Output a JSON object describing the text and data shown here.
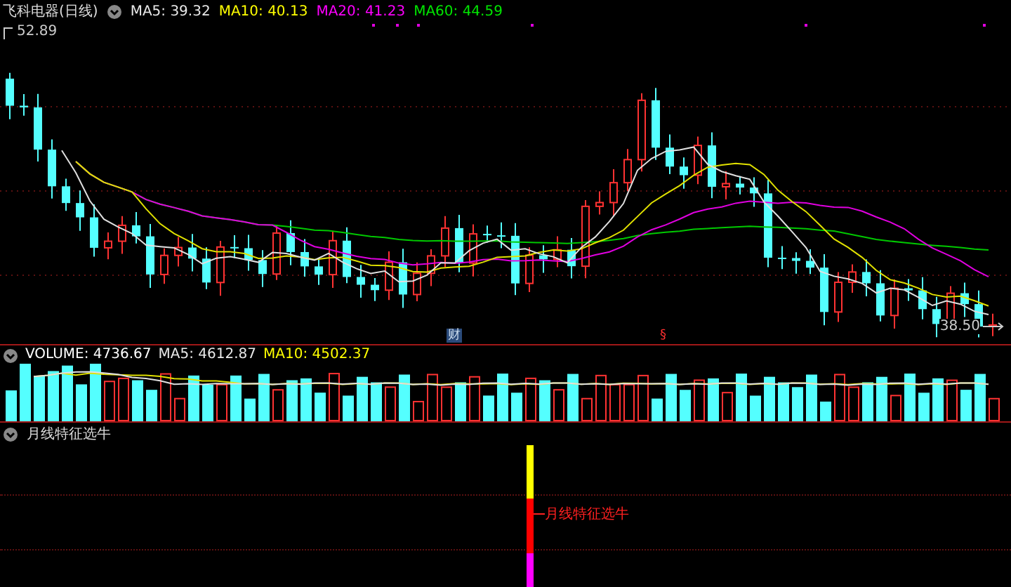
{
  "price_panel": {
    "title": "飞科电器(日线)",
    "indicators": [
      {
        "label": "MA5: 39.32",
        "color": "#e8e8e8"
      },
      {
        "label": "MA10: 40.13",
        "color": "#ffff00"
      },
      {
        "label": "MA20: 41.23",
        "color": "#ff00ff"
      },
      {
        "label": "MA60: 44.59",
        "color": "#00e600"
      }
    ],
    "high_label": "52.89",
    "low_label": "38.50",
    "markers": [
      {
        "text": "财",
        "kind": "finance"
      },
      {
        "text": "§",
        "kind": "event"
      }
    ]
  },
  "volume_panel": {
    "indicators": [
      {
        "label": "VOLUME: 4736.67",
        "color": "#ffffff"
      },
      {
        "label": "MA5: 4612.87",
        "color": "#e8e8e8"
      },
      {
        "label": "MA10: 4502.37",
        "color": "#ffff00"
      }
    ]
  },
  "signal_panel": {
    "title": "月线特征选牛",
    "signal_label": "月线特征选牛"
  }
}
